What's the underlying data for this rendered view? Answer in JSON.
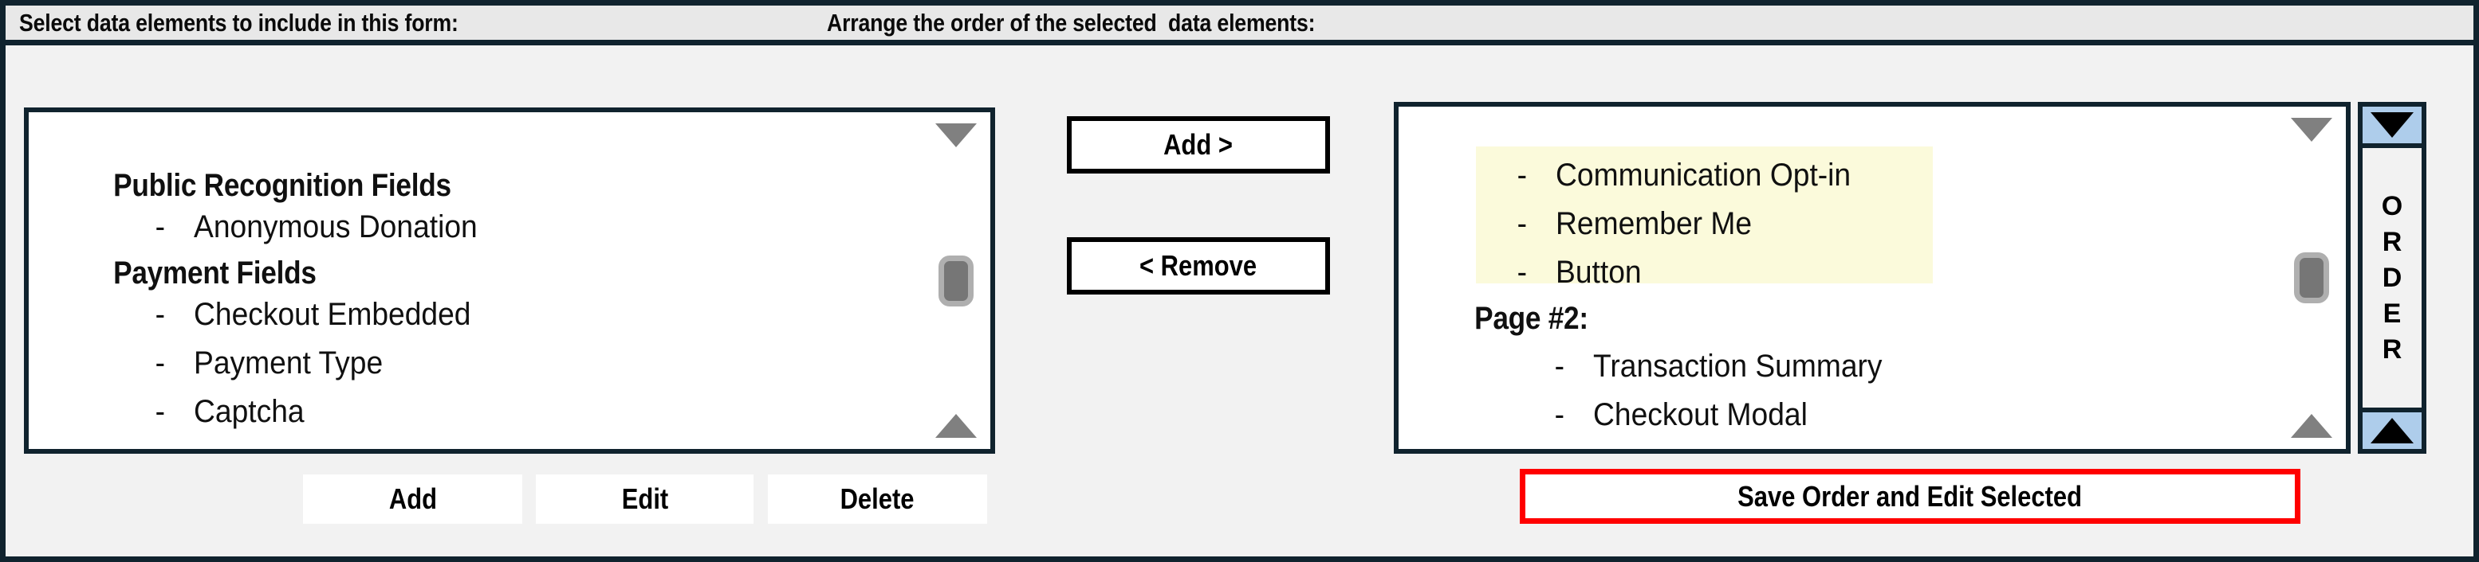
{
  "headers": {
    "left": "Select data elements to include in this form:",
    "right": "Arrange the order of the selected  data elements:"
  },
  "colors": {
    "frame": "#10232E",
    "header_band": "#E8E8E8",
    "body": "#F2F2F2",
    "listbox_bg": "#FFFFFF",
    "highlight": "#FBFADB",
    "order_button": "#AECDEB",
    "save_border": "#FF0000",
    "scroll_thumb": "#767676",
    "scroll_arrow": "#808080"
  },
  "available_list": {
    "name": "available-data-elements",
    "rows": [
      {
        "type": "group",
        "label": "Public Recognition Fields"
      },
      {
        "type": "item",
        "label": "Anonymous Donation"
      },
      {
        "type": "group",
        "label": "Payment Fields"
      },
      {
        "type": "item",
        "label": "Checkout Embedded"
      },
      {
        "type": "item",
        "label": "Payment Type"
      },
      {
        "type": "item",
        "label": "Captcha"
      }
    ],
    "scrollbar": {
      "down_arrow_icon": "triangle-down-icon",
      "up_arrow_icon": "triangle-up-icon",
      "thumb_icon": "scrollbar-thumb"
    }
  },
  "selected_list": {
    "name": "selected-data-elements",
    "rows": [
      {
        "type": "item",
        "label": "Communication Opt-in",
        "highlighted": false
      },
      {
        "type": "item",
        "label": "Remember Me",
        "highlighted": false
      },
      {
        "type": "item",
        "label": "Button",
        "highlighted": false
      },
      {
        "type": "group",
        "label": "Page #2:",
        "highlighted": false
      },
      {
        "type": "item",
        "label": "Transaction Summary",
        "highlighted": true
      },
      {
        "type": "item",
        "label": "Checkout Modal",
        "highlighted": true
      }
    ],
    "scrollbar": {
      "down_arrow_icon": "triangle-down-icon",
      "up_arrow_icon": "triangle-up-icon",
      "thumb_icon": "scrollbar-thumb"
    }
  },
  "order_panel": {
    "up_button_icon": "triangle-up-icon",
    "down_button_icon": "triangle-down-icon",
    "letters": [
      "O",
      "R",
      "D",
      "E",
      "R"
    ]
  },
  "transfer_buttons": {
    "add": "Add >",
    "remove": "< Remove"
  },
  "left_actions": {
    "add": "Add",
    "edit": "Edit",
    "delete": "Delete"
  },
  "right_actions": {
    "save": "Save Order and Edit Selected"
  },
  "bullet": "-"
}
